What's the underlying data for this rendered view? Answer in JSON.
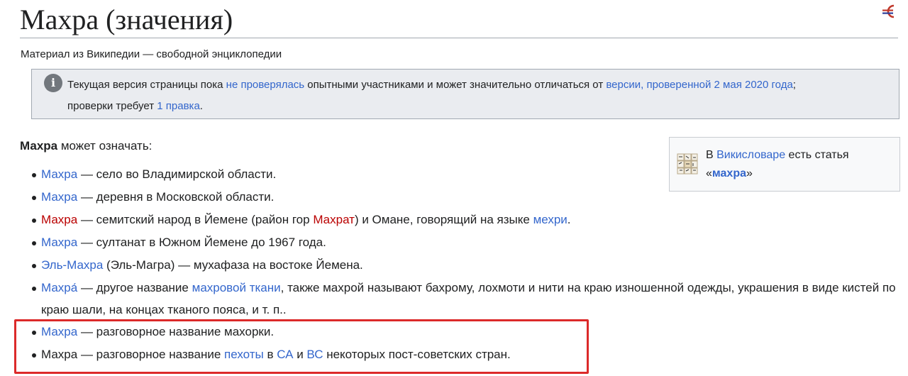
{
  "page": {
    "title": "Махра (значения)",
    "subtitle": "Материал из Википедии — свободной энциклопедии"
  },
  "notice": {
    "t1": "Текущая версия страницы пока ",
    "link1": "не проверялась",
    "t2": " опытными участниками и может значительно отличаться от ",
    "link2": "версии, проверенной 2 мая 2020 года",
    "t3": ";",
    "t4": "проверки требует ",
    "link3": "1 правка",
    "t5": "."
  },
  "wiktionary": {
    "t1": "В ",
    "link": "Викисловаре",
    "t2": " есть статья",
    "q_open": "«",
    "term": "махра",
    "q_close": "»"
  },
  "intro": {
    "bold": "Махра",
    "rest": " может означать:"
  },
  "items": [
    {
      "link": "Махра",
      "text": " — село во Владимирской области."
    },
    {
      "link": "Махра",
      "text": " — деревня в Московской области."
    },
    {
      "link": "Махра",
      "text1": " — семитский народ в Йемене (район гор ",
      "link2": "Махрат",
      "text2": ") и Омане, говорящий на языке ",
      "link3": "мехри",
      "text3": "."
    },
    {
      "link": "Махра",
      "text": " — султанат в Южном Йемене до 1967 года."
    },
    {
      "link": "Эль-Махра",
      "text": " (Эль-Магра) — мухафаза на востоке Йемена."
    },
    {
      "link": "Махра́",
      "text1": " — другое название ",
      "link2": "махровой ткани",
      "text2": ", также махрой называют бахрому, лохмоти и нити на краю изношенной одежды, украшения в виде кистей по краю шали, на концах тканого пояса, и т. п.."
    },
    {
      "link": "Махра",
      "text": " — разговорное название махорки."
    },
    {
      "plain": "Махра",
      "text1": " — разговорное название ",
      "link2": "пехоты",
      "text2": " в ",
      "link3": "СА",
      "text3": " и ",
      "link4": "ВС",
      "text4": " некоторых пост-советских стран."
    }
  ],
  "colors": {
    "link": "#3366cc",
    "redlink": "#ba0000",
    "highlight": "#dc2a2a"
  }
}
